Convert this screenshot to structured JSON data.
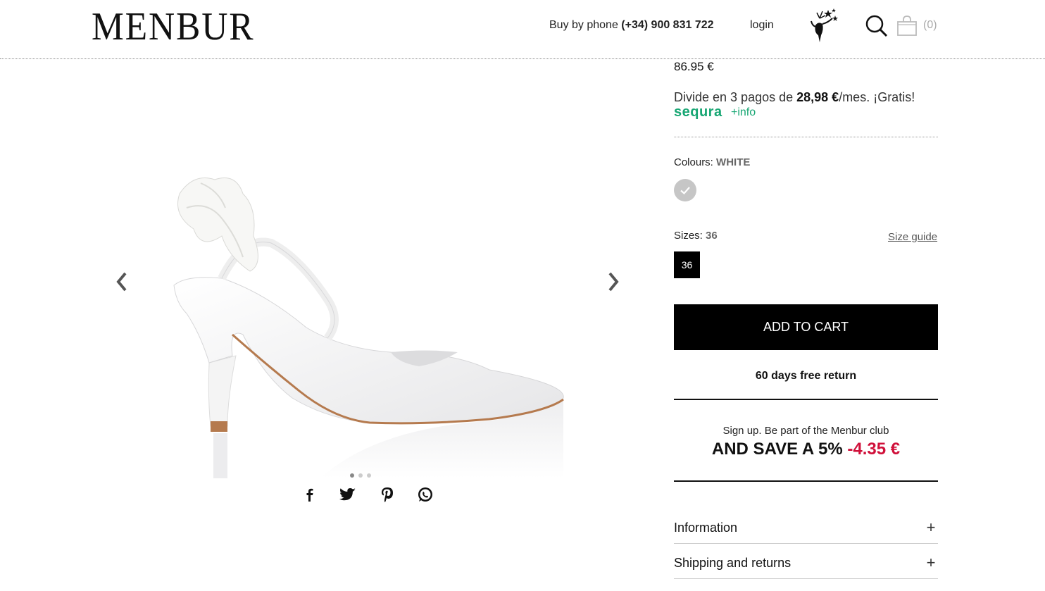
{
  "header": {
    "logo": "MENBUR",
    "phone_prefix": "Buy by phone ",
    "phone_number": "(+34) 900 831 722",
    "login": "login",
    "cart_count": "(0)"
  },
  "product": {
    "price": "86.95 €",
    "installments_prefix": "Divide en 3 pagos de ",
    "installments_amount": "28,98 €",
    "installments_suffix": "/mes. ¡Gratis!",
    "sequra_brand": "sequra",
    "sequra_more": "+info",
    "colours_label": "Colours: ",
    "colours_value": "WHITE",
    "swatch_color": "#c6c6c6",
    "sizes_label": "Sizes: ",
    "sizes_value": "36",
    "size_guide": "Size guide",
    "size_option": "36",
    "add_to_cart": "ADD TO CART",
    "free_return": "60 days free return",
    "club_line": "Sign up. Be part of the Menbur club",
    "save_text": "AND SAVE A 5% ",
    "save_discount": "-4.35 €"
  },
  "gallery": {
    "dots": 3,
    "active_dot": 0
  },
  "share_icons": [
    "facebook-icon",
    "twitter-icon",
    "pinterest-icon",
    "whatsapp-icon"
  ],
  "accordion": [
    {
      "title": "Information",
      "toggle": "+"
    },
    {
      "title": "Shipping and returns",
      "toggle": "+"
    }
  ],
  "colors": {
    "accent_green": "#17a673",
    "discount_red": "#d0103a",
    "button_black": "#000000"
  }
}
